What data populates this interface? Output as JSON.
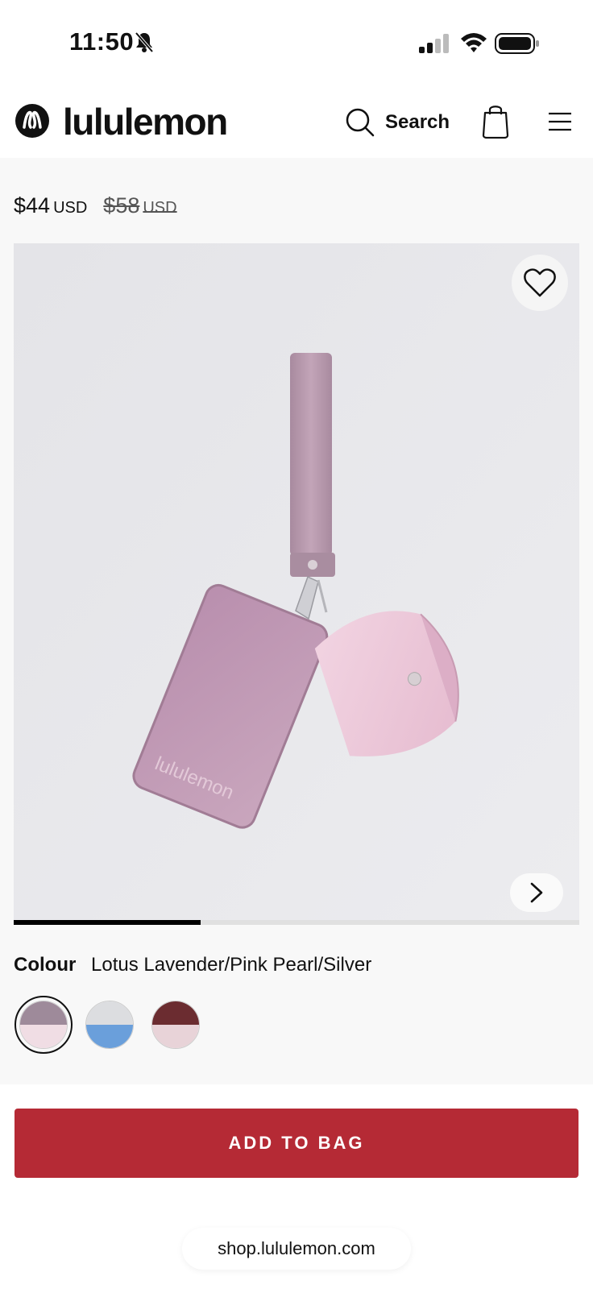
{
  "status_bar": {
    "time": "11:50",
    "icons": [
      "bell-muted-icon",
      "signal-icon",
      "wifi-icon",
      "battery-icon"
    ]
  },
  "header": {
    "brand": "lululemon",
    "search_label": "Search",
    "icons": [
      "lululemon-logo-icon",
      "search-icon",
      "shopping-bag-icon",
      "hamburger-menu-icon"
    ]
  },
  "product": {
    "price_current": "$44",
    "price_current_currency": "USD",
    "price_original": "$58",
    "price_original_currency": "USD",
    "gallery_progress_fraction": 0.33,
    "image_icons": [
      "heart-icon",
      "chevron-right-icon"
    ]
  },
  "colour": {
    "label": "Colour",
    "selected_name": "Lotus Lavender/Pink Pearl/Silver",
    "swatches": [
      {
        "top": "#9e8a9a",
        "bottom": "#f0dde4",
        "selected": true
      },
      {
        "top": "#dcdde0",
        "bottom": "#6a9fdb",
        "selected": false
      },
      {
        "top": "#6b2c30",
        "bottom": "#e8d3d8",
        "selected": false
      }
    ]
  },
  "actions": {
    "add_to_bag_label": "ADD TO BAG"
  },
  "browser": {
    "url": "shop.lululemon.com"
  },
  "colors": {
    "accent_red": "#b52a35",
    "page_bg": "#f8f8f8"
  }
}
